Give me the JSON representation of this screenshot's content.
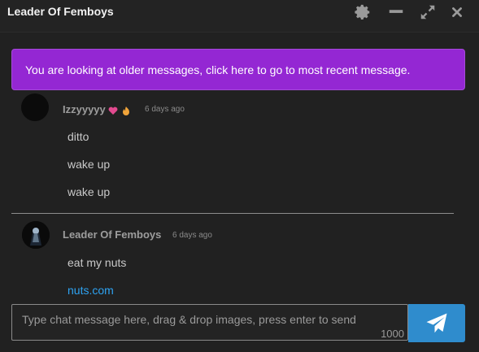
{
  "window": {
    "title": "Leader Of Femboys",
    "icons": [
      "gear-icon",
      "minimize-icon",
      "expand-icon",
      "close-icon"
    ]
  },
  "banner": {
    "text": "You are looking at older messages, click here to go to most recent message.",
    "color": "#9427d3"
  },
  "messages": [
    {
      "username": "Izzyyyyy",
      "time": "6 days ago",
      "lines": [
        "ditto",
        "wake up",
        "wake up"
      ]
    },
    {
      "username": "Leader Of Femboys",
      "time": "6 days ago",
      "lines": [
        "eat my nuts"
      ],
      "link": "nuts.com"
    }
  ],
  "composer": {
    "placeholder": "Type chat message here, drag & drop images, press enter to send",
    "char_limit": "1000",
    "send_icon": "paper-plane-icon",
    "send_color": "#2f8ccd"
  }
}
